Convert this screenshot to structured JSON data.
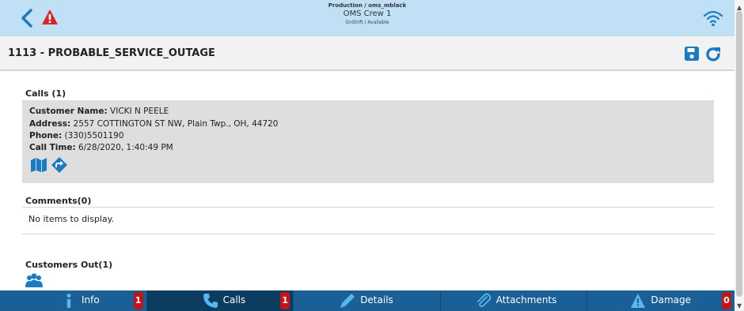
{
  "topbar": {
    "env_line1": "Production / oms_mblack",
    "env_line2": "OMS Crew 1",
    "env_line3": "OnShift / Available",
    "icons": [
      "chevron-left-icon",
      "alert-icon",
      "wifi-icon"
    ]
  },
  "header": {
    "title": "1113 - PROBABLE_SERVICE_OUTAGE",
    "icons": [
      "save-icon",
      "refresh-icon"
    ]
  },
  "calls": {
    "label": "Calls (1)",
    "items": [
      {
        "name_label": "Customer Name:",
        "name": " VICKI N PEELE",
        "address_label": "Address:",
        "address": " 2557 COTTINGTON ST NW, Plain Twp., OH, 44720",
        "phone_label": "Phone:",
        "phone": " (330)5501190",
        "time_label": "Call Time:",
        "time": " 6/28/2020, 1:40:49 PM"
      }
    ]
  },
  "comments": {
    "label": "Comments(0)",
    "empty_text": "No items to display."
  },
  "customers_out": {
    "label": "Customers Out(1)"
  },
  "nav": {
    "tabs": [
      {
        "label": "Info",
        "badge": "1",
        "icon": "info-icon"
      },
      {
        "label": "Calls",
        "badge": "1",
        "icon": "phone-icon"
      },
      {
        "label": "Details",
        "badge": "",
        "icon": "pencil-icon"
      },
      {
        "label": "Attachments",
        "badge": "",
        "icon": "paperclip-icon"
      },
      {
        "label": "Damage",
        "badge": "0",
        "icon": "warning-icon"
      }
    ]
  },
  "colors": {
    "topbar_bg": "#bfe0f5",
    "accent_blue": "#1a7bc2",
    "nav_bg": "#1a5f96",
    "nav_active": "#0d3c61",
    "badge_red": "#c0161b",
    "alert_red": "#d8232a"
  }
}
